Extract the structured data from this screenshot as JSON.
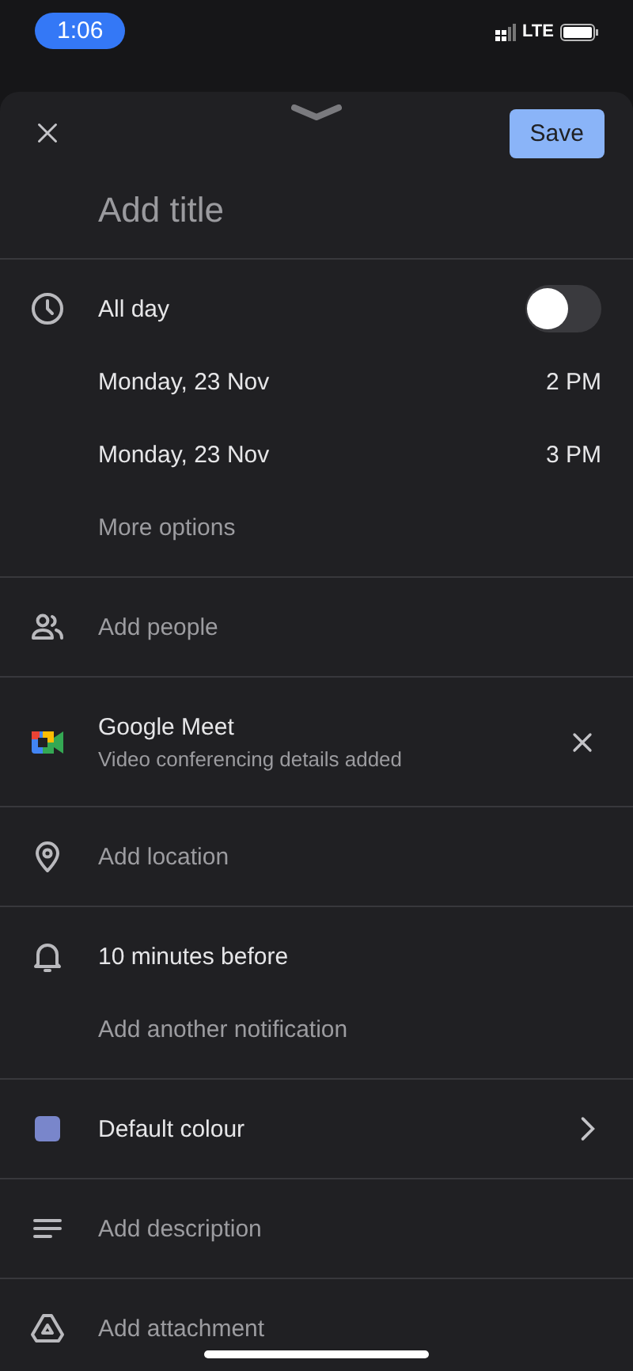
{
  "status_bar": {
    "time": "1:06",
    "network": "LTE"
  },
  "header": {
    "save": "Save"
  },
  "title": {
    "placeholder": "Add title"
  },
  "sections": [
    {
      "kind": "time",
      "rows": [
        {
          "kind": "toggle",
          "label": "All day",
          "on": false
        },
        {
          "kind": "datetime",
          "date": "Monday, 23 Nov",
          "time": "2 PM"
        },
        {
          "kind": "datetime",
          "date": "Monday, 23 Nov",
          "time": "3 PM"
        },
        {
          "kind": "hint",
          "label": "More options"
        }
      ]
    },
    {
      "kind": "people",
      "rows": [
        {
          "kind": "hint",
          "label": "Add people"
        }
      ]
    },
    {
      "kind": "meet",
      "rows": [
        {
          "kind": "meet",
          "label": "Google Meet",
          "detail": "Video conferencing details added"
        }
      ]
    },
    {
      "kind": "location",
      "rows": [
        {
          "kind": "hint",
          "label": "Add location"
        }
      ]
    },
    {
      "kind": "notification",
      "rows": [
        {
          "kind": "value",
          "label": "10 minutes before"
        },
        {
          "kind": "hint",
          "label": "Add another notification"
        }
      ]
    },
    {
      "kind": "colour",
      "rows": [
        {
          "kind": "colour",
          "label": "Default colour",
          "color": "#7986cb"
        }
      ]
    },
    {
      "kind": "description",
      "rows": [
        {
          "kind": "hint",
          "label": "Add description"
        }
      ]
    },
    {
      "kind": "attachment",
      "rows": [
        {
          "kind": "hint",
          "label": "Add attachment"
        }
      ]
    }
  ]
}
